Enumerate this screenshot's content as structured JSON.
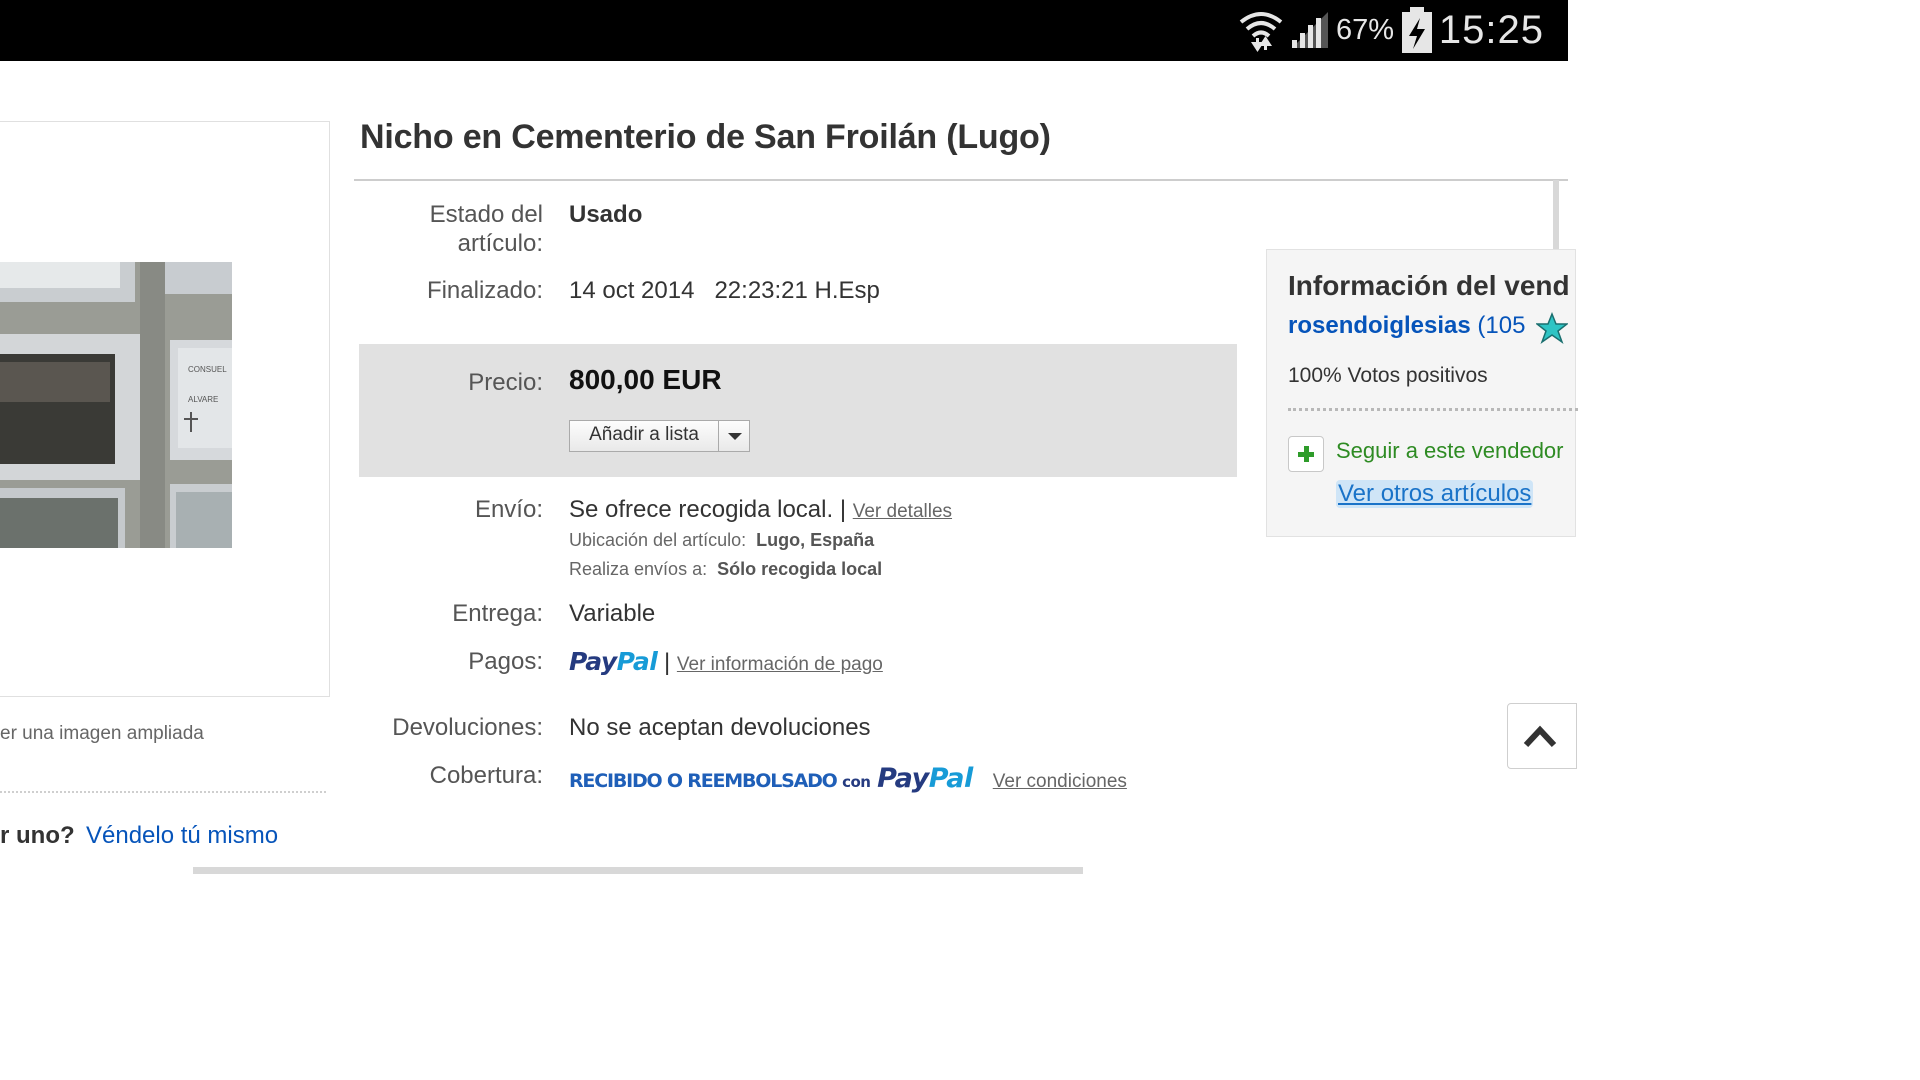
{
  "status_bar": {
    "battery": "67%",
    "time": "15:25",
    "icons": [
      "wifi-icon",
      "signal-icon",
      "battery-charging-icon"
    ]
  },
  "left": {
    "enlarge_text": "er una imagen ampliada",
    "sell_question": "r uno?",
    "sell_link": "Véndelo tú mismo"
  },
  "listing": {
    "title": "Nicho en Cementerio de San Froilán (Lugo)",
    "condition_label": "Estado del artículo:",
    "condition_label_1": "Estado del",
    "condition_label_2": "artículo:",
    "condition_value": "Usado",
    "ended_label": "Finalizado:",
    "ended_date": "14 oct 2014",
    "ended_time": "22:23:21 H.Esp",
    "price_label": "Precio:",
    "price_value": "800,00 EUR",
    "add_to_list": "Añadir a lista",
    "shipping_label": "Envío:",
    "shipping_value": "Se ofrece recogida local.",
    "shipping_sep": "|",
    "shipping_link": "Ver detalles",
    "location_label": "Ubicación del artículo:",
    "location_value": "Lugo, España",
    "ships_to_label": "Realiza envíos a:",
    "ships_to_value": "Sólo recogida local",
    "delivery_label": "Entrega:",
    "delivery_value": "Variable",
    "payments_label": "Pagos:",
    "paypal_a": "Pay",
    "paypal_b": "Pal",
    "payments_sep": "|",
    "payments_link": "Ver información de pago",
    "returns_label": "Devoluciones:",
    "returns_value": "No se aceptan devoluciones",
    "coverage_label": "Cobertura:",
    "coverage_text": "RECIBIDO O REEMBOLSADO",
    "coverage_con": "con",
    "coverage_link": "Ver condiciones"
  },
  "seller": {
    "title": "Información del vend",
    "name": "rosendoiglesias",
    "count": "(105",
    "positive": "100% Votos positivos",
    "follow": "Seguir a este vendedor",
    "other_items": "Ver otros artículos"
  },
  "colors": {
    "link_blue": "#0654ba",
    "paypal_dark": "#253b80",
    "paypal_light": "#179bd7",
    "follow_green": "#2e8b23",
    "price_bg": "#e1e1e1"
  }
}
